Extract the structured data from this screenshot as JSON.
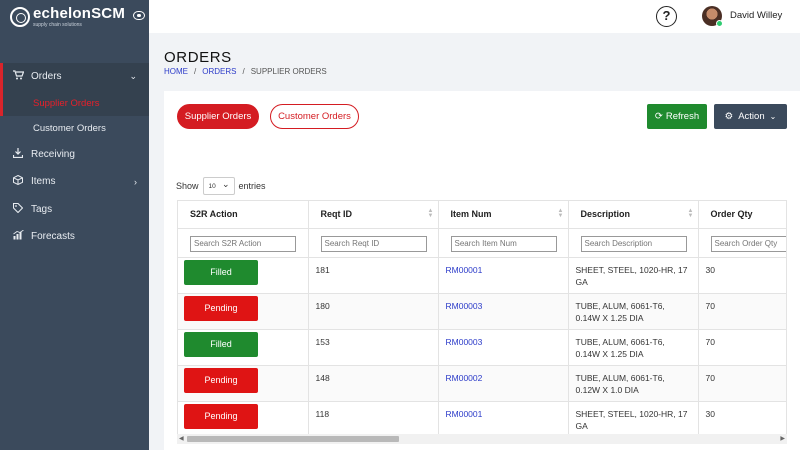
{
  "brand": {
    "name": "echelonSCM",
    "tagline": "supply chain solutions"
  },
  "sidebar": {
    "items": [
      {
        "label": "Orders",
        "icon": "cart-icon"
      },
      {
        "label": "Receiving",
        "icon": "download-icon"
      },
      {
        "label": "Items",
        "icon": "cube-icon"
      },
      {
        "label": "Tags",
        "icon": "tag-icon"
      },
      {
        "label": "Forecasts",
        "icon": "chart-icon"
      }
    ],
    "orders_sub": [
      "Supplier Orders",
      "Customer Orders"
    ]
  },
  "user": {
    "name": "David Willey"
  },
  "page": {
    "title": "ORDERS",
    "breadcrumb": [
      "HOME",
      "ORDERS",
      "SUPPLIER ORDERS"
    ]
  },
  "toolbar": {
    "supplier_orders": "Supplier Orders",
    "customer_orders": "Customer Orders",
    "refresh": "Refresh",
    "action": "Action"
  },
  "show": {
    "prefix": "Show",
    "value": "10",
    "suffix": "entries"
  },
  "table": {
    "columns": [
      "S2R Action",
      "Reqt ID",
      "Item Num",
      "Description",
      "Order Qty"
    ],
    "search_placeholders": [
      "Search S2R Action",
      "Search Reqt ID",
      "Search Item Num",
      "Search Description",
      "Search Order Qty"
    ],
    "rows": [
      {
        "status": "Filled",
        "reqt_id": "181",
        "item": "RM00001",
        "desc": "SHEET, STEEL, 1020-HR, 17 GA",
        "qty": "30"
      },
      {
        "status": "Pending",
        "reqt_id": "180",
        "item": "RM00003",
        "desc": "TUBE, ALUM, 6061-T6, 0.14W X 1.25 DIA",
        "qty": "70"
      },
      {
        "status": "Filled",
        "reqt_id": "153",
        "item": "RM00003",
        "desc": "TUBE, ALUM, 6061-T6, 0.14W X 1.25 DIA",
        "qty": "70"
      },
      {
        "status": "Pending",
        "reqt_id": "148",
        "item": "RM00002",
        "desc": "TUBE, ALUM, 6061-T6, 0.12W X 1.0 DIA",
        "qty": "70"
      },
      {
        "status": "Pending",
        "reqt_id": "118",
        "item": "RM00001",
        "desc": "SHEET, STEEL, 1020-HR, 17 GA",
        "qty": "30"
      }
    ]
  },
  "colors": {
    "sidebar": "#3b4a5c",
    "accent_red": "#d41c22",
    "filled": "#1f8a2e",
    "pending": "#df1414",
    "link": "#2d3cc9"
  }
}
